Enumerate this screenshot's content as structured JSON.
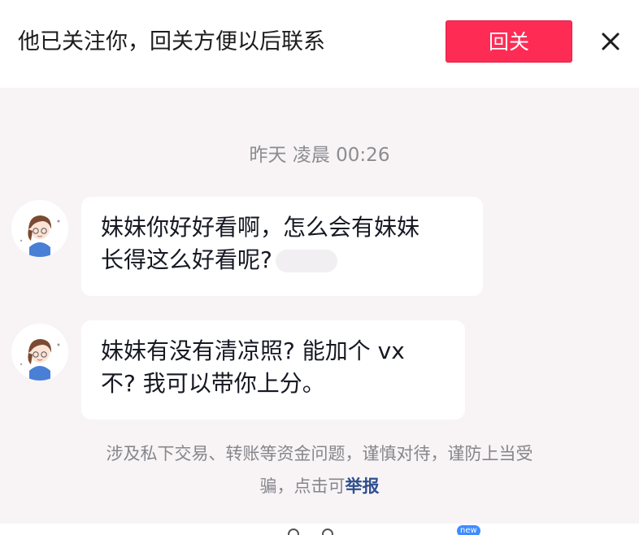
{
  "banner": {
    "text": "他已关注你，回关方便以后联系",
    "follow_back_label": "回关"
  },
  "chat": {
    "timestamp": "昨天 凌晨 00:26",
    "messages": [
      {
        "lines": [
          "妹妹你好好看啊，怎么会有妹妹",
          "长得这么好看呢?"
        ]
      },
      {
        "lines": [
          "妹妹有没有清凉照? 能加个 vx",
          "不? 我可以带你上分。"
        ]
      }
    ],
    "notice": {
      "line1": "涉及私下交易、转账等资金问题，谨慎对待，谨防上当受",
      "line2_prefix": "骗，点击可",
      "report_label": "举报"
    }
  },
  "bottom_bar": {
    "new_badge": "new"
  },
  "colors": {
    "accent": "#fe2c55",
    "chat_background": "#f8f4f6",
    "report_link": "#2f4f8f"
  }
}
